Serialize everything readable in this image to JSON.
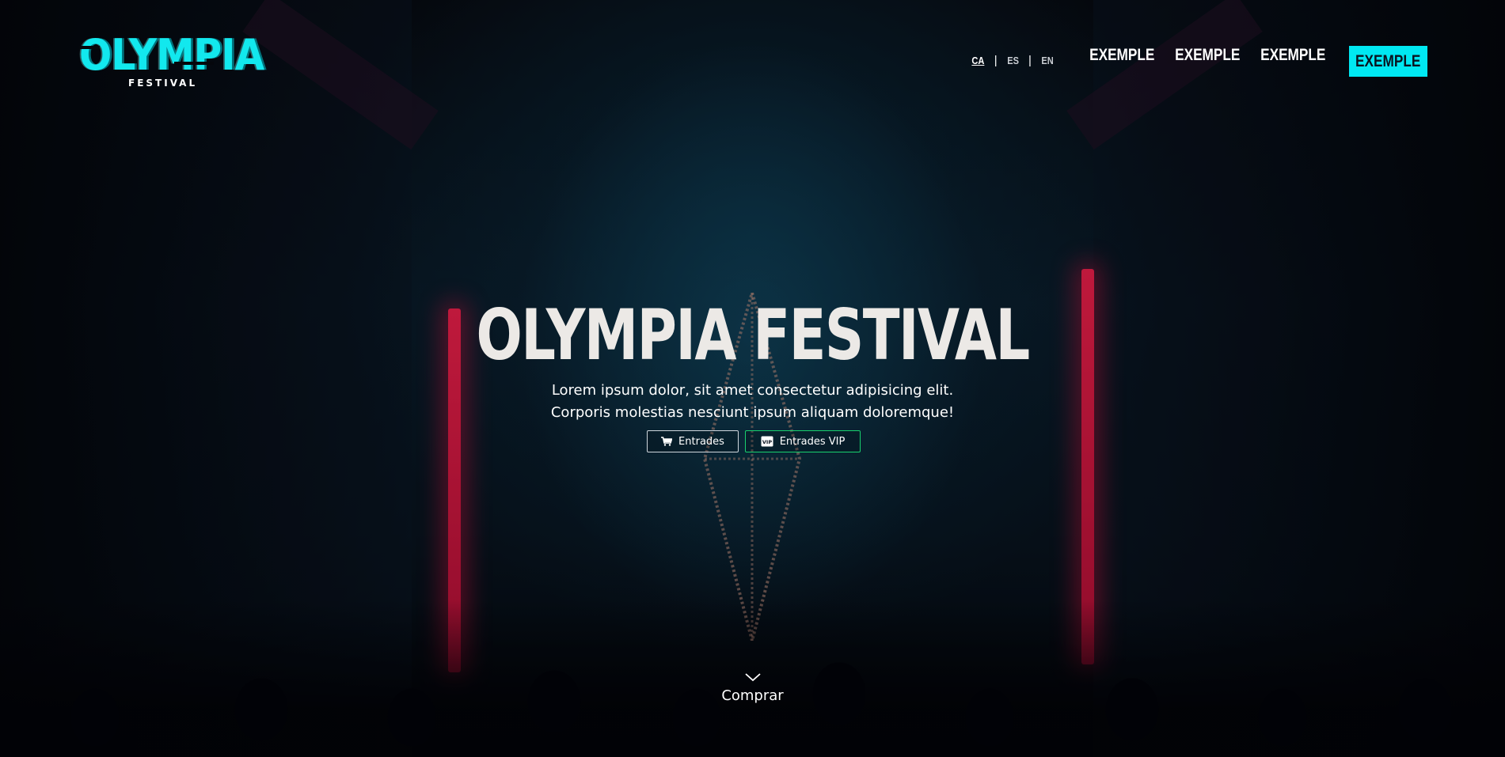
{
  "brand": {
    "name": "OLYMPIA",
    "subtitle": "FESTIVAL",
    "accent_color": "#00e8f2"
  },
  "languages": [
    {
      "code": "CA",
      "active": true
    },
    {
      "code": "ES",
      "active": false
    },
    {
      "code": "EN",
      "active": false
    }
  ],
  "language_separator": "|",
  "nav": {
    "items": [
      "EXEMPLE",
      "EXEMPLE",
      "EXEMPLE"
    ],
    "cta": "EXEMPLE"
  },
  "hero": {
    "title": "OLYMPIA FESTIVAL",
    "text_line1": "Lorem ipsum dolor, sit amet consectetur adipisicing elit.",
    "text_line2": "Corporis molestias nesciunt ipsum aliquam doloremque!",
    "buttons": [
      {
        "label": "Entrades",
        "icon": "cart-icon",
        "border_color": "#cfd6dc"
      },
      {
        "label": "Entrades VIP",
        "icon": "vip-icon",
        "border_color": "#18d16e"
      }
    ],
    "scroll_icon": "chevron-down-icon",
    "scroll_label": "Comprar"
  }
}
